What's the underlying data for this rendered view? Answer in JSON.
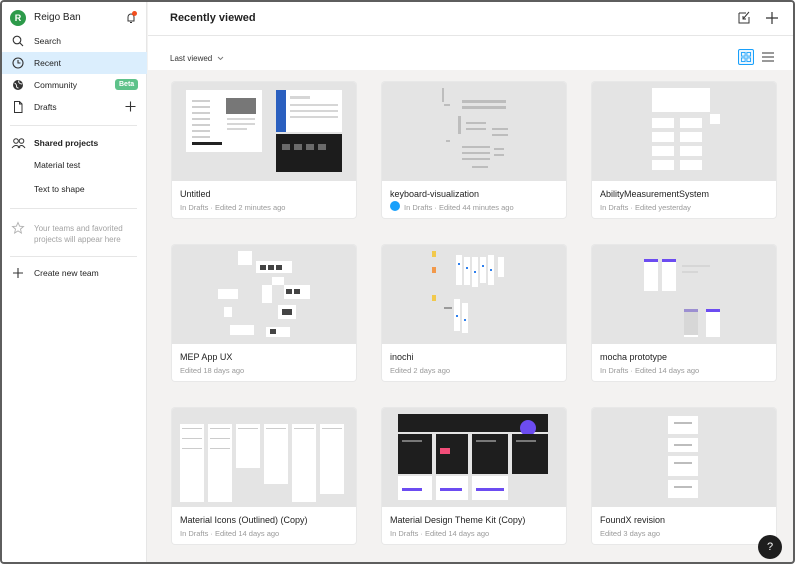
{
  "user": {
    "initial": "R",
    "name": "Reigo Ban"
  },
  "sidebar": {
    "items": [
      {
        "label": "Search"
      },
      {
        "label": "Recent"
      },
      {
        "label": "Community",
        "badge": "Beta"
      },
      {
        "label": "Drafts"
      }
    ],
    "shared_title": "Shared projects",
    "projects": [
      "Material test",
      "Text to shape"
    ],
    "empty_note": "Your teams and favorited projects will appear here",
    "create_team": "Create new team"
  },
  "header": {
    "title": "Recently viewed"
  },
  "toolbar": {
    "sort_label": "Last viewed"
  },
  "files": [
    {
      "title": "Untitled",
      "meta": "In Drafts · Edited 2 minutes ago"
    },
    {
      "title": "keyboard-visualization",
      "meta": "In Drafts · Edited 44 minutes ago"
    },
    {
      "title": "AbilityMeasurementSystem",
      "meta": "In Drafts · Edited yesterday"
    },
    {
      "title": "MEP App UX",
      "meta": "Edited 18 days ago"
    },
    {
      "title": "inochi",
      "meta": "Edited 2 days ago"
    },
    {
      "title": "mocha prototype",
      "meta": "In Drafts · Edited 14 days ago"
    },
    {
      "title": "Material Icons (Outlined) (Copy)",
      "meta": "In Drafts · Edited 14 days ago"
    },
    {
      "title": "Material Design Theme Kit (Copy)",
      "meta": "In Drafts · Edited 14 days ago"
    },
    {
      "title": "FoundX revision",
      "meta": "Edited 3 days ago"
    }
  ],
  "help": {
    "label": "?"
  },
  "colors": {
    "accent": "#18a0fb",
    "active_bg": "#dbeefd",
    "beta": "#5ec28a",
    "avatar": "#2d9a4a"
  }
}
